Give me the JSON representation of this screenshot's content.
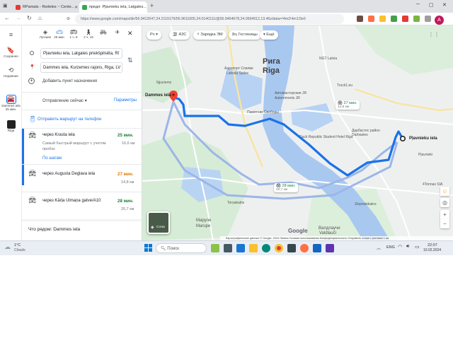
{
  "browser": {
    "tabs": [
      {
        "title": "RPamats - Redeles ~ Cente..."
      },
      {
        "title": "предл: Pļavnieku iela, Latgales..."
      }
    ],
    "url": "https://www.google.com/maps/dir/56.9412647,24.2119176/56.9611605,24.0140111/@56.9464678,24.0594912,13.46z/data=!4m2!4m1!3e0"
  },
  "rail": {
    "items": [
      {
        "label": "Сохранен"
      },
      {
        "label": "Недавние"
      },
      {
        "label": "Dammes iela\n25 мин."
      },
      {
        "label": "Rīga"
      }
    ]
  },
  "directions": {
    "modes": [
      {
        "icon": "best-route-icon",
        "label": "Лучшие"
      },
      {
        "icon": "car-icon",
        "label": "25 мин."
      },
      {
        "icon": "transit-icon",
        "label": "1 ч. 9"
      },
      {
        "icon": "walk-icon",
        "label": "2 ч. 19"
      },
      {
        "icon": "bicycle-icon",
        "label": ""
      },
      {
        "icon": "flight-icon",
        "label": ""
      }
    ],
    "origin": "Pļavnieku iela, Latgales priekšpilsēta, Rī",
    "destination": "Dammes iela, Kurzemes rajons, Riga, LV",
    "add_destination": "Добавить пункт назначения",
    "depart": "Отправление сейчас",
    "options": "Параметры",
    "send_to_phone": "Отправить маршрут на телефон",
    "routes": [
      {
        "via": "через Krasta iela",
        "time": "25 мин.",
        "distance": "16,6 км",
        "note": "Самый быстрый маршрут с учетом пробок",
        "details": "По шагам"
      },
      {
        "via": "через Augusta Deglava iela",
        "time": "27 мин.",
        "distance": "14,8 км"
      },
      {
        "via": "через Kārļa Ulmaņa gatve/A10",
        "time": "28 мин.",
        "distance": "20,7 км"
      }
    ],
    "nearby": "Что рядом: Dammes iela"
  },
  "map": {
    "chips": [
      {
        "label": "Рч"
      },
      {
        "label": "АЗС"
      },
      {
        "label": "Зарядка ЭМ"
      },
      {
        "label": "Гостиницы"
      },
      {
        "label": "Ещё"
      }
    ],
    "city": {
      "ru": "Рига",
      "lv": "Riga"
    },
    "labels": [
      "Аэропорт Спилве",
      "Lidosta Spilve",
      "NGT Latvia",
      "Автомастерские JR",
      "Autoremonts JR",
      "Памятник Свободы",
      "Truck1.eu",
      "Duck Republic Student Hotel Riga",
      "Дарбастес район",
      "Darbastes",
      "Маруле",
      "Marupe",
      "Валдлаучи",
      "Valdlauči",
      "4Tonnas SIA",
      "Ziepniekkalns",
      "Torņakalns",
      "Ilģuciems",
      "Pļavnieki"
    ],
    "origin_label": "Pļavnieku iela",
    "dest_label": "Dammes iela",
    "route_badges": [
      {
        "time": "27 мин.",
        "dist": "14,8 км"
      },
      {
        "time": "28 мин.",
        "dist": "20,7 км"
      }
    ],
    "layer_label": "Слои",
    "brand": "Google",
    "attribution": "Картографические данные © Google, 2024    Латвия    Условия использования    Конфиденциальность    Отправить отзыв о рекламе   1 км"
  },
  "taskbar": {
    "weather_temp": "1°C",
    "weather_desc": "Clouds",
    "search": "Поиск",
    "lang": "ENG",
    "time": "22:07",
    "date": "10.02.2024"
  }
}
